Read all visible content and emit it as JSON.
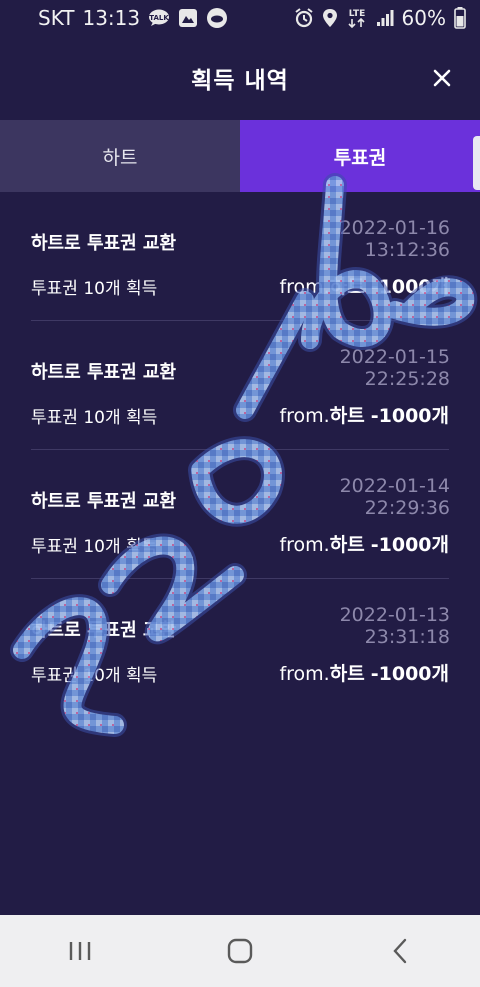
{
  "status_bar": {
    "carrier": "SKT",
    "time": "13:13",
    "network": "LTE",
    "battery": "60%",
    "notification_icons": [
      "talk-icon",
      "gallery-icon",
      "face-icon"
    ],
    "system_icons": [
      "alarm-icon",
      "location-icon",
      "lte-icon",
      "signal-icon",
      "battery-icon"
    ]
  },
  "header": {
    "title": "획득 내역",
    "close_icon": "close-icon"
  },
  "tabs": [
    {
      "label": "하트",
      "active": false
    },
    {
      "label": "투표권",
      "active": true
    }
  ],
  "colors": {
    "background": "#221c45",
    "active_tab": "#6b31db",
    "inactive_tab": "#3c3660",
    "date_text": "#8d88ab"
  },
  "history": [
    {
      "title": "하트로 투표권 교환",
      "desc": "투표권 10개 획득",
      "date": "2022-01-16",
      "time": "13:12:36",
      "from": "from.",
      "source": "하트",
      "amount": "-1000개"
    },
    {
      "title": "하트로 투표권 교환",
      "desc": "투표권 10개 획득",
      "date": "2022-01-15",
      "time": "22:25:28",
      "from": "from.",
      "source": "하트",
      "amount": "-1000개"
    },
    {
      "title": "하트로 투표권 교환",
      "desc": "투표권 10개 획득",
      "date": "2022-01-14",
      "time": "22:29:36",
      "from": "from.",
      "source": "하트",
      "amount": "-1000개"
    },
    {
      "title": "하트로 투표권 교환",
      "desc": "투표권 10개 획득",
      "date": "2022-01-13",
      "time": "23:31:18",
      "from": "from.",
      "source": "하트",
      "amount": "-1000개"
    }
  ],
  "nav_bar": {
    "buttons": [
      "recent-apps-icon",
      "home-icon",
      "back-icon"
    ]
  }
}
